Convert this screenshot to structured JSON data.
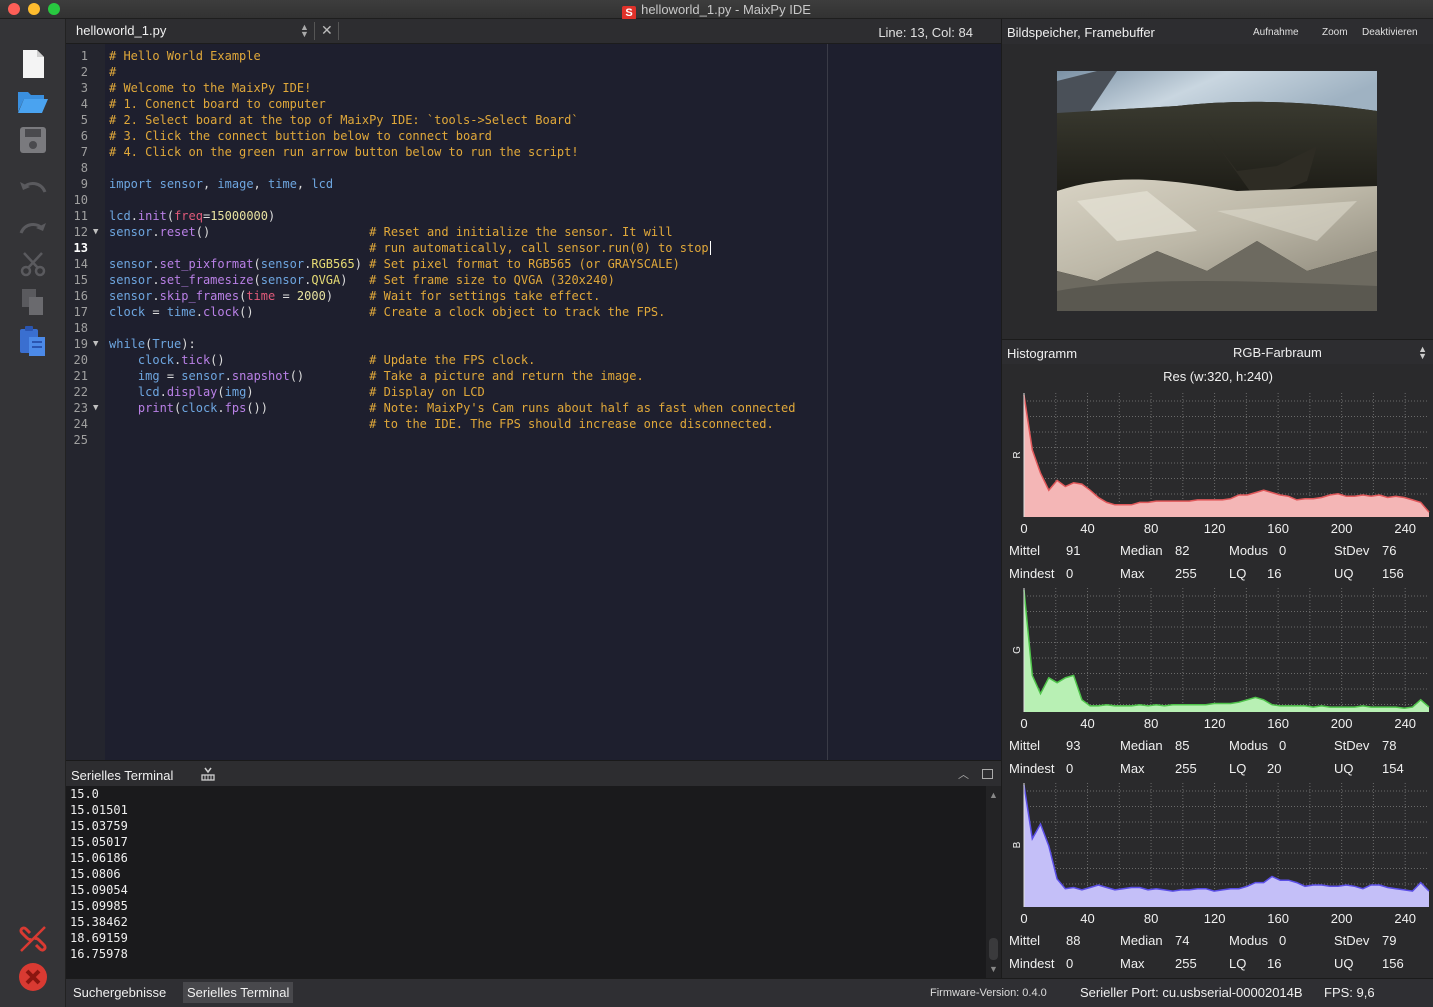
{
  "window": {
    "title": "helloworld_1.py - MaixPy IDE",
    "logo_letter": "S"
  },
  "toolbar": {
    "buttons": [
      {
        "name": "new-file",
        "icon": "new-file-icon"
      },
      {
        "name": "open-file",
        "icon": "open-folder-icon"
      },
      {
        "name": "save-file",
        "icon": "save-icon"
      },
      {
        "name": "undo",
        "icon": "undo-icon"
      },
      {
        "name": "redo",
        "icon": "redo-icon"
      },
      {
        "name": "cut",
        "icon": "scissors-icon"
      },
      {
        "name": "copy",
        "icon": "copy-icon"
      },
      {
        "name": "paste",
        "icon": "paste-icon"
      },
      {
        "name": "disconnect",
        "icon": "disconnect-icon"
      },
      {
        "name": "stop",
        "icon": "stop-icon"
      }
    ]
  },
  "editor": {
    "tab_label": "helloworld_1.py",
    "cursor_position": "Line: 13, Col: 84",
    "current_line": 13,
    "lines": [
      "# Hello World Example",
      "#",
      "# Welcome to the MaixPy IDE!",
      "# 1. Conenct board to computer",
      "# 2. Select board at the top of MaixPy IDE: `tools->Select Board`",
      "# 3. Click the connect buttion below to connect board",
      "# 4. Click on the green run arrow button below to run the script!",
      "",
      "import sensor, image, time, lcd",
      "",
      "lcd.init(freq=15000000)",
      "sensor.reset()                      # Reset and initialize the sensor. It will",
      "                                    # run automatically, call sensor.run(0) to stop",
      "sensor.set_pixformat(sensor.RGB565) # Set pixel format to RGB565 (or GRAYSCALE)",
      "sensor.set_framesize(sensor.QVGA)   # Set frame size to QVGA (320x240)",
      "sensor.skip_frames(time = 2000)     # Wait for settings take effect.",
      "clock = time.clock()                # Create a clock object to track the FPS.",
      "",
      "while(True):",
      "    clock.tick()                    # Update the FPS clock.",
      "    img = sensor.snapshot()         # Take a picture and return the image.",
      "    lcd.display(img)                # Display on LCD",
      "    print(clock.fps())              # Note: MaixPy's Cam runs about half as fast when connected",
      "                                    # to the IDE. The FPS should increase once disconnected.",
      ""
    ],
    "fold_markers": [
      12,
      19,
      23
    ]
  },
  "terminal": {
    "title": "Serielles Terminal",
    "lines": [
      "15.0",
      "15.01501",
      "15.03759",
      "15.05017",
      "15.06186",
      "15.0806",
      "15.09054",
      "15.09985",
      "15.38462",
      "18.69159",
      "16.75978"
    ]
  },
  "statusbar": {
    "tab_search": "Suchergebnisse",
    "tab_terminal": "Serielles Terminal",
    "firmware": "Firmware-Version: 0.4.0",
    "serial_port": "Serieller Port: cu.usbserial-00002014B",
    "fps": "FPS:   9,6"
  },
  "framebuffer": {
    "title": "Bildspeicher, Framebuffer",
    "record_label": "Aufnahme",
    "zoom_label": "Zoom",
    "disable_label": "Deaktivieren"
  },
  "histogram": {
    "title": "Histogramm",
    "colorspace": "RGB-Farbraum",
    "resolution": "Res (w:320, h:240)",
    "x_ticks": [
      "0",
      "40",
      "80",
      "120",
      "160",
      "200",
      "240"
    ],
    "channels": [
      {
        "label": "R",
        "fill": "#f4b6b6",
        "stroke": "#e0585a",
        "values": [
          1.0,
          0.55,
          0.36,
          0.22,
          0.3,
          0.25,
          0.28,
          0.27,
          0.22,
          0.16,
          0.12,
          0.1,
          0.1,
          0.1,
          0.12,
          0.12,
          0.13,
          0.13,
          0.13,
          0.13,
          0.13,
          0.14,
          0.14,
          0.14,
          0.14,
          0.15,
          0.18,
          0.18,
          0.2,
          0.22,
          0.2,
          0.18,
          0.17,
          0.14,
          0.15,
          0.15,
          0.16,
          0.18,
          0.19,
          0.17,
          0.17,
          0.18,
          0.17,
          0.18,
          0.16,
          0.17,
          0.16,
          0.14,
          0.12,
          0.04
        ],
        "stats": {
          "mean_label": "Mittel",
          "mean": "91",
          "median_label": "Median",
          "median": "82",
          "mode_label": "Modus",
          "mode": "0",
          "stdev_label": "StDev",
          "stdev": "76",
          "min_label": "Mindest",
          "min": "0",
          "max_label": "Max",
          "max": "255",
          "lq_label": "LQ",
          "lq": "16",
          "uq_label": "UQ",
          "uq": "156"
        }
      },
      {
        "label": "G",
        "fill": "#b8f0b4",
        "stroke": "#4fc44b",
        "values": [
          1.0,
          0.3,
          0.15,
          0.28,
          0.24,
          0.28,
          0.3,
          0.1,
          0.05,
          0.05,
          0.06,
          0.05,
          0.05,
          0.05,
          0.06,
          0.05,
          0.06,
          0.05,
          0.06,
          0.06,
          0.06,
          0.06,
          0.06,
          0.07,
          0.07,
          0.07,
          0.08,
          0.1,
          0.12,
          0.1,
          0.06,
          0.05,
          0.05,
          0.05,
          0.05,
          0.04,
          0.05,
          0.04,
          0.04,
          0.04,
          0.04,
          0.05,
          0.04,
          0.04,
          0.04,
          0.04,
          0.03,
          0.04,
          0.1,
          0.04
        ],
        "stats": {
          "mean_label": "Mittel",
          "mean": "93",
          "median_label": "Median",
          "median": "85",
          "mode_label": "Modus",
          "mode": "0",
          "stdev_label": "StDev",
          "stdev": "78",
          "min_label": "Mindest",
          "min": "0",
          "max_label": "Max",
          "max": "255",
          "lq_label": "LQ",
          "lq": "20",
          "uq_label": "UQ",
          "uq": "154"
        }
      },
      {
        "label": "B",
        "fill": "#c4bff8",
        "stroke": "#5a4ee6",
        "values": [
          1.0,
          0.56,
          0.68,
          0.5,
          0.23,
          0.15,
          0.16,
          0.14,
          0.16,
          0.18,
          0.16,
          0.14,
          0.15,
          0.16,
          0.16,
          0.14,
          0.15,
          0.14,
          0.13,
          0.14,
          0.14,
          0.15,
          0.15,
          0.13,
          0.14,
          0.15,
          0.15,
          0.17,
          0.2,
          0.2,
          0.25,
          0.22,
          0.22,
          0.2,
          0.17,
          0.18,
          0.18,
          0.17,
          0.17,
          0.18,
          0.17,
          0.15,
          0.18,
          0.18,
          0.16,
          0.15,
          0.14,
          0.13,
          0.2,
          0.13
        ],
        "stats": {
          "mean_label": "Mittel",
          "mean": "88",
          "median_label": "Median",
          "median": "74",
          "mode_label": "Modus",
          "mode": "0",
          "stdev_label": "StDev",
          "stdev": "79",
          "min_label": "Mindest",
          "min": "0",
          "max_label": "Max",
          "max": "255",
          "lq_label": "LQ",
          "lq": "16",
          "uq_label": "UQ",
          "uq": "156"
        }
      }
    ]
  }
}
